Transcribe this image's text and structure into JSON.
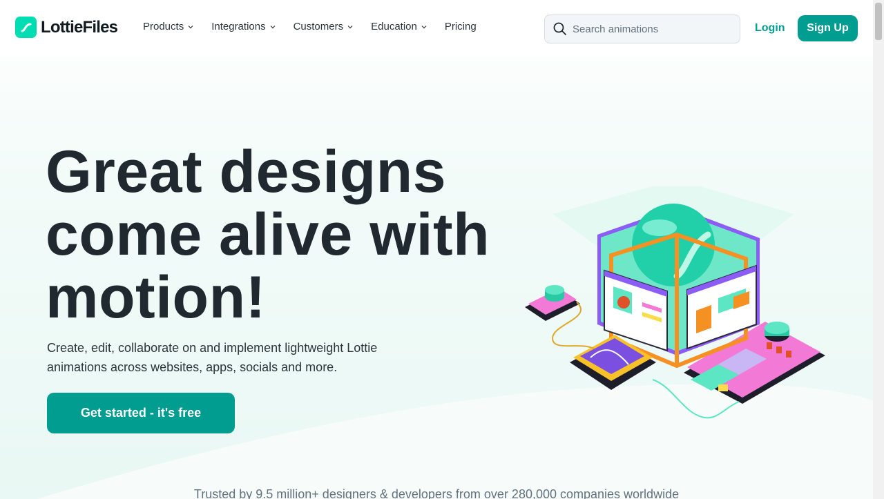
{
  "header": {
    "logo_text": "LottieFiles",
    "nav": [
      {
        "label": "Products",
        "has_dropdown": true
      },
      {
        "label": "Integrations",
        "has_dropdown": true
      },
      {
        "label": "Customers",
        "has_dropdown": true
      },
      {
        "label": "Education",
        "has_dropdown": true
      },
      {
        "label": "Pricing",
        "has_dropdown": false
      }
    ],
    "search_placeholder": "Search animations",
    "login_label": "Login",
    "signup_label": "Sign Up"
  },
  "hero": {
    "title_lines": [
      "Great designs",
      "come alive with",
      "motion!"
    ],
    "subtitle": "Create, edit, collaborate on and implement lightweight Lottie animations across websites, apps, socials and more.",
    "cta_label": "Get started - it's free",
    "illustration_icon": "isometric-animation-studio-icon"
  },
  "trusted_text": "Trusted by 9.5 million+ designers & developers from over 280,000 companies worldwide",
  "colors": {
    "brand": "#019d91",
    "brand_light": "#00ddb3",
    "text_dark": "#20292f",
    "muted": "#63727e"
  }
}
